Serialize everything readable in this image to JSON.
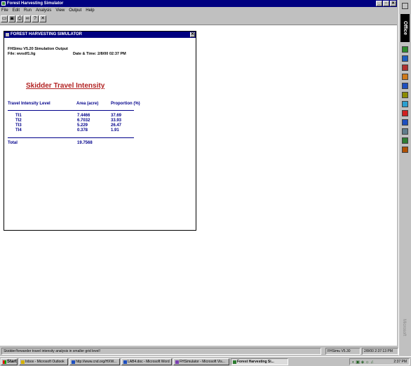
{
  "app": {
    "title": "Forest Harvesting Simulator",
    "menus": [
      "File",
      "Edit",
      "Run",
      "Analysis",
      "View",
      "Output",
      "Help"
    ]
  },
  "toolbar": [
    "open-icon",
    "save-icon",
    "print-icon",
    "binoculars-icon",
    "help-icon",
    "close-icon"
  ],
  "child_window": {
    "title": "FOREST HARVESTING SIMULATOR",
    "line1": "FHSimu V5.20 Simulation Output",
    "file_label": "File: wvsdf1.lig",
    "datetime": "Date & Time: 2/8/00 02:37 PM",
    "report_title": "Skidder Travel Intensity",
    "columns": [
      "Travel Intensity Level",
      "Area (acre)",
      "Proportion (%)"
    ],
    "rows": [
      {
        "level": "TI1",
        "area": "7.4466",
        "proportion": "37.69"
      },
      {
        "level": "TI2",
        "area": "6.7032",
        "proportion": "33.93"
      },
      {
        "level": "TI3",
        "area": "5.229",
        "proportion": "26.47"
      },
      {
        "level": "TI4",
        "area": "0.378",
        "proportion": "1.91"
      }
    ],
    "total_label": "Total",
    "total_area": "19.7568"
  },
  "statusbar": {
    "message": "Skidder/forwarder travel intensity analysis in smaller grid level!",
    "version": "FHSimu V5.30",
    "datetime": "2/8/00 2:37:13 PM"
  },
  "taskbar": {
    "start": "Start",
    "tasks": [
      {
        "label": "Inbox - Microsoft Outlook",
        "color": "#d4b000"
      },
      {
        "label": "http://www.cnd.org/HXW...",
        "color": "#1e4fbf"
      },
      {
        "label": "LAB4.doc - Microsoft Word",
        "color": "#1e4fbf"
      },
      {
        "label": "FHSimulator - Microsoft Vis...",
        "color": "#7a3fb0"
      },
      {
        "label": "Forest Harvesting Si...",
        "color": "#2e7d32"
      }
    ],
    "clock": "2:37 PM"
  },
  "office_bar": {
    "logo": "Office",
    "footer": "Microsoft",
    "icon_colors": [
      "#2e8b2e",
      "#1e5fbf",
      "#b03030",
      "#d07a1a",
      "#1e4fbf",
      "#8b8b00",
      "#2a9fd0",
      "#d02020",
      "#1e4fbf",
      "#607d8b",
      "#2e7d32",
      "#b05000"
    ]
  }
}
